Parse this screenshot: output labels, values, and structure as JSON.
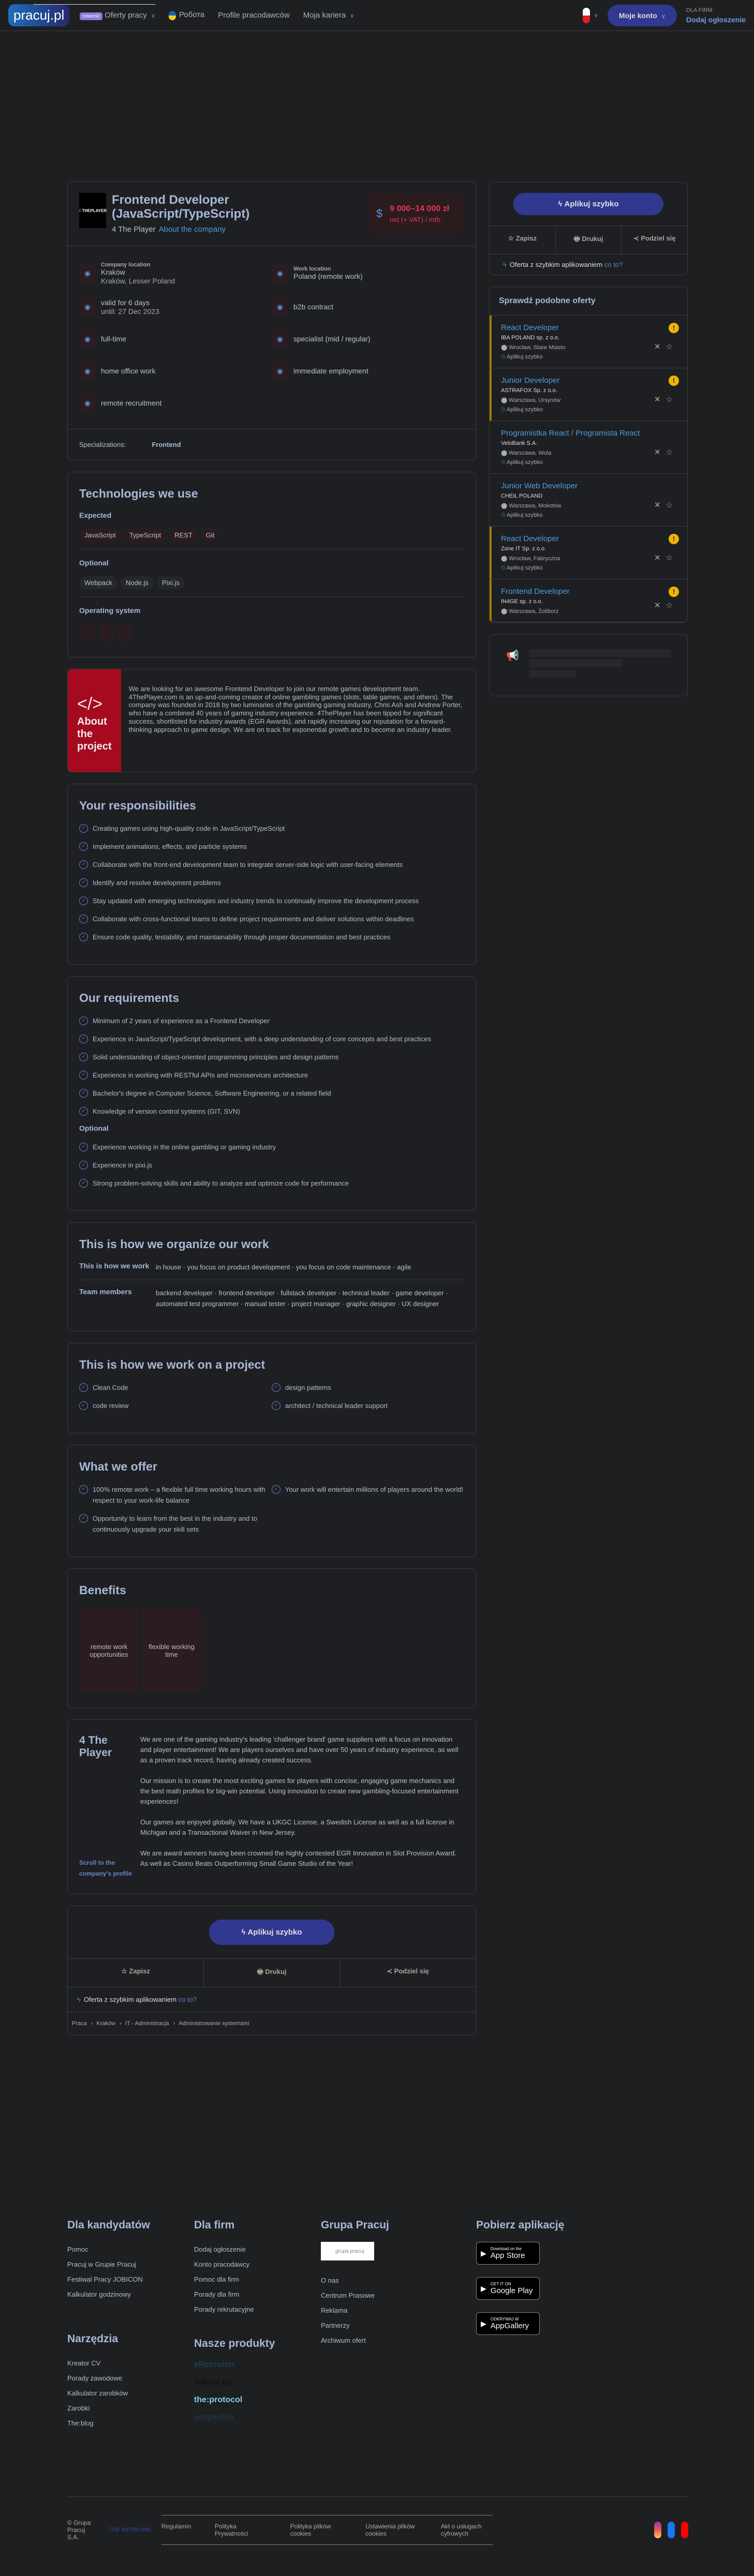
{
  "header": {
    "logo": "pracuj.pl",
    "nav": [
      {
        "badge": "nowość",
        "label": "Oferty pracy"
      },
      {
        "label": "Робота"
      },
      {
        "label": "Profile pracodawców"
      },
      {
        "label": "Moja kariera"
      }
    ],
    "account": "Moje konto",
    "for_firms": "DLA FIRM",
    "add_ad": "Dodaj ogłoszenie"
  },
  "offer": {
    "company_logo": "4THEPLAYER.COM",
    "title": "Frontend Developer (JavaScript/TypeScript)",
    "company": "4 The Player",
    "about_link": "About the company",
    "salary": "9 000–14 000 zł",
    "salary_note": "net (+ VAT) / mth.",
    "details": [
      {
        "label": "Company location",
        "value": "Kraków",
        "value2": "Kraków, Lesser Poland",
        "icon": "location-pin-icon"
      },
      {
        "label": "Work location",
        "value": "Poland (remote work)",
        "value2": null,
        "icon": "house-wifi-icon"
      },
      {
        "label": null,
        "value": "valid for 6 days",
        "value2": "until: 27 Dec 2023",
        "icon": "clock-icon"
      },
      {
        "label": null,
        "value": "b2b contract",
        "value2": null,
        "icon": "document-icon"
      },
      {
        "label": null,
        "value": "full-time",
        "value2": null,
        "icon": "pie-icon"
      },
      {
        "label": null,
        "value": "specialist (mid / regular)",
        "value2": null,
        "icon": "bars-icon"
      },
      {
        "label": null,
        "value": "home office work",
        "value2": null,
        "icon": "desk-icon"
      },
      {
        "label": null,
        "value": "immediate employment",
        "value2": null,
        "icon": "flame-icon"
      },
      {
        "label": null,
        "value": "remote recruitment",
        "value2": null,
        "icon": "phone-chat-icon"
      }
    ],
    "specializations_label": "Specializations:",
    "specialization": "Frontend"
  },
  "tech": {
    "title": "Technologies we use",
    "expected_label": "Expected",
    "expected": [
      "JavaScript",
      "TypeScript",
      "REST",
      "Git"
    ],
    "optional_label": "Optional",
    "optional": [
      "Webpack",
      "Node.js",
      "Pixi.js"
    ],
    "os_label": "Operating system"
  },
  "project": {
    "title": "About the project",
    "text": "We are looking for an awesome Frontend Developer to join our remote games development team. 4ThePlayer.com is an up-and-coming creator of online gambling games (slots, table games, and others). The company was founded in 2018 by two luminaries of the gambling gaming industry, Chris Ash and Andrew Porter, who have a combined 40 years of gaming industry experience. 4ThePlayer has been tipped for significant success, shortlisted for industry awards (EGR Awards), and rapidly increasing our reputation for a forward-thinking approach to game design. We are on track for exponential growth and to become an industry leader."
  },
  "responsibilities": {
    "title": "Your responsibilities",
    "items": [
      "Creating games using high-quality code in JavaScript/TypeScript",
      "Implement animations, effects, and particle systems",
      "Collaborate with the front-end development team to integrate server-side logic with user-facing elements",
      "Identify and resolve development problems",
      "Stay updated with emerging technologies and industry trends to continually improve the development process",
      "Collaborate with cross-functional teams to define project requirements and deliver solutions within deadlines",
      "Ensure code quality, testability, and maintainability through proper documentation and best practices"
    ]
  },
  "requirements": {
    "title": "Our requirements",
    "items": [
      "Minimum of 2 years of experience as a Frontend Developer",
      "Experience in JavaScript/TypeScript development, with a deep understanding of core concepts and best practices",
      "Solid understanding of object-oriented programming principles and design patterns",
      "Experience in working with RESTful APIs and microservices architecture",
      "Bachelor's degree in Computer Science, Software Engineering, or a related field",
      "Knowledge of version control systems (GIT, SVN)"
    ],
    "optional_label": "Optional",
    "optional": [
      "Experience working in the online gambling or gaming industry",
      "Experience in pixi.js",
      "Strong problem-solving skills and ability to analyze and optimize code for performance"
    ]
  },
  "organize": {
    "title": "This is how we organize our work",
    "work_label": "This is how we work",
    "work": [
      "in house",
      "you focus on product development",
      "you focus on code maintenance",
      "agile"
    ],
    "team_label": "Team members",
    "team": [
      "backend developer",
      "frontend developer",
      "fullstack developer",
      "technical leader",
      "game developer",
      "automated test programmer",
      "manual tester",
      "project manager",
      "graphic designer",
      "UX designer"
    ]
  },
  "work_on_project": {
    "title": "This is how we work on a project",
    "left": [
      "Clean Code",
      "code review"
    ],
    "right": [
      "design patterns",
      "architect / technical leader support"
    ]
  },
  "offer_section": {
    "title": "What we offer",
    "left": [
      "100% remote work – a flexible full time working hours with respect to your work-life balance",
      "Opportunity to learn from the best in the industry and to continuously upgrade your skill sets"
    ],
    "right": [
      "Your work will entertain millions of players around the world!"
    ]
  },
  "benefits": {
    "title": "Benefits",
    "items": [
      "remote work opportunities",
      "flexible working time"
    ]
  },
  "company": {
    "name": "4 The Player",
    "scroll_link": "Scroll to the company's profile",
    "paragraphs": [
      "We are one of the gaming industry's leading 'challenger brand' game suppliers with a focus on innovation and player entertainment! We are players ourselves and have over 50 years of industry experience, as well as a proven track record, having already created success.",
      "Our mission is to create the most exciting games for players with concise, engaging game mechanics and the best math profiles for big-win potential. Using innovation to create new gambling-focused entertainment experiences!",
      "Our games are enjoyed globally. We have a UKGC License, a Swedish License as well as a full license in Michigan and a Transactional Waiver in New Jersey.",
      "We are award winners having been crowned the highly contested EGR Innovation in Slot Provision Award. As well as Casino Beats Outperforming Small Game Studio of the Year!"
    ]
  },
  "actions": {
    "apply": "Aplikuj szybko",
    "save": "Zapisz",
    "print": "Drukuj",
    "share": "Podziel się",
    "quick_note": "Oferta z szybkim aplikowaniem",
    "what_is": "co to?"
  },
  "breadcrumbs": [
    "Praca",
    "Kraków",
    "IT - Administracja",
    "Administrowanie systemami"
  ],
  "similar": {
    "title": "Sprawdź podobne oferty",
    "offers": [
      {
        "title": "React Developer",
        "company": "IBA POLAND sp. z o.o.",
        "location": "Wrocław, Stare Miasto",
        "quick_apply": "Aplikuj szybko",
        "featured": true
      },
      {
        "title": "Junior Developer",
        "company": "ASTRAFOX Sp. z o.o.",
        "location": "Warszawa, Ursynów",
        "quick_apply": "Aplikuj szybko",
        "featured": true
      },
      {
        "title": "Programistka React / Programista React",
        "company": "VeloBank S.A.",
        "location": "Warszawa, Wola",
        "quick_apply": "Aplikuj szybko",
        "featured": false
      },
      {
        "title": "Junior Web Developer",
        "company": "CHEIL POLAND",
        "location": "Warszawa, Mokotów",
        "quick_apply": "Aplikuj szybko",
        "featured": false
      },
      {
        "title": "React Developer",
        "company": "Zone IT Sp. z o.o.",
        "location": "Wrocław, Fabryczna",
        "quick_apply": "Aplikuj szybko",
        "featured": true
      },
      {
        "title": "Frontend Developer",
        "company": "IN4GE sp. z o.o.",
        "location": "Warszawa, Żoliborz",
        "quick_apply": null,
        "featured": true
      }
    ]
  },
  "footer": {
    "candidates": {
      "title": "Dla kandydatów",
      "links": [
        "Pomoc",
        "Pracuj w Grupie Pracuj",
        "Festiwal Pracy JOBICON",
        "Kalkulator godzinowy"
      ]
    },
    "firms": {
      "title": "Dla firm",
      "links": [
        "Dodaj ogłoszenie",
        "Konto pracodawcy",
        "Pomoc dla firm",
        "Porady dla firm",
        "Porady rekrutacyjne"
      ]
    },
    "group": {
      "title": "Grupa Pracuj",
      "logo": "grupa pracuj",
      "links": [
        "O nas",
        "Centrum Prasowe",
        "Reklama",
        "Partnerzy",
        "Archiwum ofert"
      ]
    },
    "app": {
      "title": "Pobierz aplikację",
      "stores": [
        {
          "small": "Download on the",
          "big": "App Store"
        },
        {
          "small": "GET IT ON",
          "big": "Google Play"
        },
        {
          "small": "ODKRYWAJ W",
          "big": "AppGallery"
        }
      ]
    },
    "tools": {
      "title": "Narzędzia",
      "links": [
        "Kreator CV",
        "Porady zawodowe",
        "Kalkulator zarobków",
        "Zarobki",
        "The:blog"
      ]
    },
    "products": {
      "title": "Nasze produkty",
      "items": [
        "eRecruiter",
        "robota.ua",
        "the:protocol",
        "softgarden"
      ]
    },
    "copyright": "© Grupa Pracuj S.A.",
    "network": "THE NETWORK",
    "legal": [
      "Regulamin",
      "Polityka Prywatności",
      "Polityka plików cookies",
      "Ustawienia plików cookies",
      "Akt o usługach cyfrowych"
    ]
  },
  "colors": {
    "accent": "#313890",
    "salary": "#e83650",
    "link": "#4c9de0",
    "project_red": "#a60a1f",
    "featured": "#a57700"
  }
}
